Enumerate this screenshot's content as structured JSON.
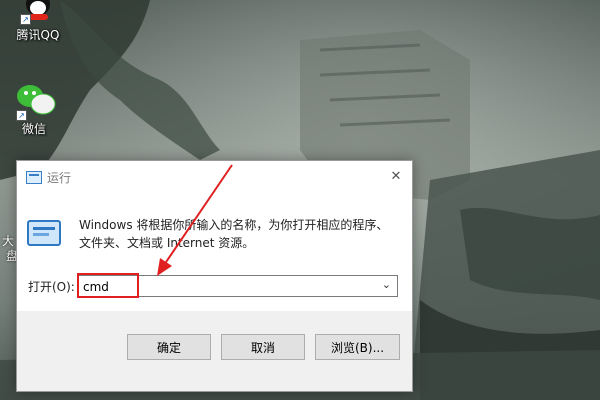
{
  "desktop": {
    "icons": [
      {
        "label": "腾讯QQ",
        "icon": "qq-penguin-icon"
      },
      {
        "label": "微信",
        "icon": "wechat-icon"
      }
    ],
    "partial_label_line1": "大",
    "partial_label_line2": "盘"
  },
  "run_dialog": {
    "title": "运行",
    "close_glyph": "✕",
    "description_line1": "Windows 将根据你所输入的名称，为你打开相应的程序、",
    "description_line2": "文件夹、文档或 Internet 资源。",
    "open_label": "打开(O):",
    "open_value": "cmd",
    "buttons": {
      "ok": "确定",
      "cancel": "取消",
      "browse": "浏览(B)..."
    }
  },
  "colors": {
    "annotation_red": "#e02020",
    "dialog_footer": "#f0f0f0",
    "title_text": "#7a7a7a"
  }
}
